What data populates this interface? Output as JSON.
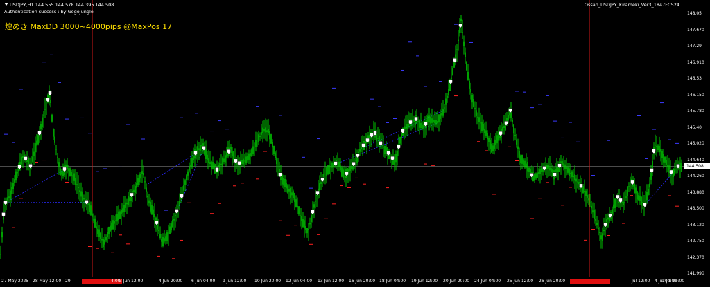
{
  "header": {
    "symbol_line": "USDJPY,H1  144.555 144.578 144.395 144.508",
    "auth_text": "Authentication success : by GogoJungle",
    "ea_name": "Ossan_USDJPY_Kirameki_Ver3_1847FC524",
    "tagline": "煌めき MaxDD 3000~4000pips @MaxPos 17"
  },
  "colors": {
    "background": "#000000",
    "candle": "#00c800",
    "buy_marker": "#3a3aff",
    "sell_marker": "#ff2020",
    "vline": "#d01818",
    "hline": "#c8c8c8",
    "trade_line": "#2a2aff"
  },
  "price_scale": {
    "labels": [
      "148.05",
      "147.670",
      "147.29",
      "146.910",
      "146.53",
      "146.150",
      "145.780",
      "145.40",
      "145.020",
      "144.640",
      "144.260",
      "143.880",
      "143.500",
      "143.120",
      "142.750",
      "142.370",
      "141.990"
    ],
    "current_price": "144.508"
  },
  "time_axis": {
    "labels": [
      "27 May 2025",
      "28 May 12:00",
      "29",
      "",
      "4:00",
      "3 Jun 12:00",
      "4 Jun 20:00",
      "6 Jun 04:00",
      "9 Jun 12:00",
      "10 Jun 20:00",
      "12 Jun 04:00",
      "13 Jun 12:00",
      "16 Jun 20:00",
      "18 Jun 04:00",
      "19 Jun 12:00",
      "20 Jun 20:00",
      "24 Jun 04:00",
      "25 Jun 12:00",
      "26 Jun 20:00",
      "",
      "Jul 12:00",
      "2 Jul 20:00",
      "4 Jul 04:00"
    ],
    "highlighted": [
      3,
      19
    ]
  },
  "chart_data": {
    "type": "line",
    "title": "",
    "xlabel": "",
    "ylabel": "",
    "ylim": [
      141.99,
      148.05
    ],
    "x_count": 240,
    "key_points": [
      [
        0,
        142.22
      ],
      [
        6,
        143.6
      ],
      [
        14,
        143.8
      ],
      [
        24,
        144.3
      ],
      [
        34,
        144.75
      ],
      [
        44,
        144.5
      ],
      [
        56,
        145.2
      ],
      [
        66,
        145.9
      ],
      [
        72,
        146.2
      ],
      [
        76,
        145.4
      ],
      [
        82,
        144.8
      ],
      [
        88,
        144.3
      ],
      [
        96,
        144.5
      ],
      [
        108,
        144.2
      ],
      [
        118,
        143.8
      ],
      [
        128,
        143.6
      ],
      [
        136,
        143.2
      ],
      [
        142,
        142.95
      ],
      [
        150,
        142.7
      ],
      [
        160,
        143.1
      ],
      [
        170,
        143.3
      ],
      [
        182,
        143.6
      ],
      [
        196,
        144.0
      ],
      [
        206,
        144.4
      ],
      [
        214,
        143.7
      ],
      [
        224,
        143.3
      ],
      [
        234,
        142.7
      ],
      [
        242,
        142.9
      ],
      [
        252,
        143.3
      ],
      [
        262,
        143.8
      ],
      [
        272,
        144.4
      ],
      [
        282,
        144.8
      ],
      [
        292,
        145.0
      ],
      [
        302,
        144.6
      ],
      [
        312,
        144.4
      ],
      [
        322,
        144.6
      ],
      [
        332,
        144.9
      ],
      [
        342,
        144.55
      ],
      [
        352,
        144.6
      ],
      [
        362,
        144.8
      ],
      [
        372,
        145.1
      ],
      [
        380,
        145.35
      ],
      [
        388,
        145.3
      ],
      [
        396,
        144.8
      ],
      [
        404,
        144.3
      ],
      [
        414,
        144.0
      ],
      [
        424,
        143.8
      ],
      [
        434,
        143.3
      ],
      [
        444,
        142.95
      ],
      [
        452,
        143.5
      ],
      [
        460,
        144.0
      ],
      [
        468,
        144.3
      ],
      [
        478,
        144.5
      ],
      [
        488,
        144.6
      ],
      [
        496,
        144.25
      ],
      [
        504,
        144.4
      ],
      [
        512,
        144.6
      ],
      [
        520,
        144.9
      ],
      [
        530,
        145.1
      ],
      [
        540,
        145.3
      ],
      [
        550,
        145.0
      ],
      [
        560,
        144.8
      ],
      [
        570,
        144.6
      ],
      [
        580,
        145.3
      ],
      [
        590,
        145.5
      ],
      [
        600,
        145.6
      ],
      [
        610,
        145.4
      ],
      [
        620,
        145.6
      ],
      [
        630,
        145.5
      ],
      [
        640,
        145.8
      ],
      [
        648,
        146.3
      ],
      [
        654,
        146.8
      ],
      [
        660,
        147.3
      ],
      [
        665,
        147.9
      ],
      [
        670,
        147.2
      ],
      [
        676,
        146.5
      ],
      [
        682,
        146.0
      ],
      [
        690,
        145.6
      ],
      [
        700,
        145.3
      ],
      [
        710,
        144.9
      ],
      [
        720,
        145.2
      ],
      [
        730,
        145.5
      ],
      [
        736,
        145.8
      ],
      [
        742,
        145.3
      ],
      [
        750,
        144.7
      ],
      [
        760,
        144.5
      ],
      [
        770,
        144.2
      ],
      [
        780,
        144.4
      ],
      [
        790,
        144.5
      ],
      [
        800,
        144.3
      ],
      [
        810,
        144.6
      ],
      [
        820,
        144.4
      ],
      [
        830,
        144.2
      ],
      [
        840,
        144.0
      ],
      [
        850,
        143.7
      ],
      [
        856,
        143.4
      ],
      [
        862,
        143.1
      ],
      [
        868,
        142.8
      ],
      [
        874,
        143.2
      ],
      [
        882,
        143.4
      ],
      [
        890,
        143.8
      ],
      [
        900,
        143.6
      ],
      [
        910,
        144.2
      ],
      [
        920,
        143.8
      ],
      [
        930,
        143.6
      ],
      [
        938,
        144.1
      ],
      [
        944,
        145.0
      ],
      [
        952,
        144.9
      ],
      [
        960,
        144.6
      ],
      [
        970,
        144.3
      ],
      [
        978,
        144.5
      ],
      [
        986,
        144.5
      ]
    ]
  }
}
